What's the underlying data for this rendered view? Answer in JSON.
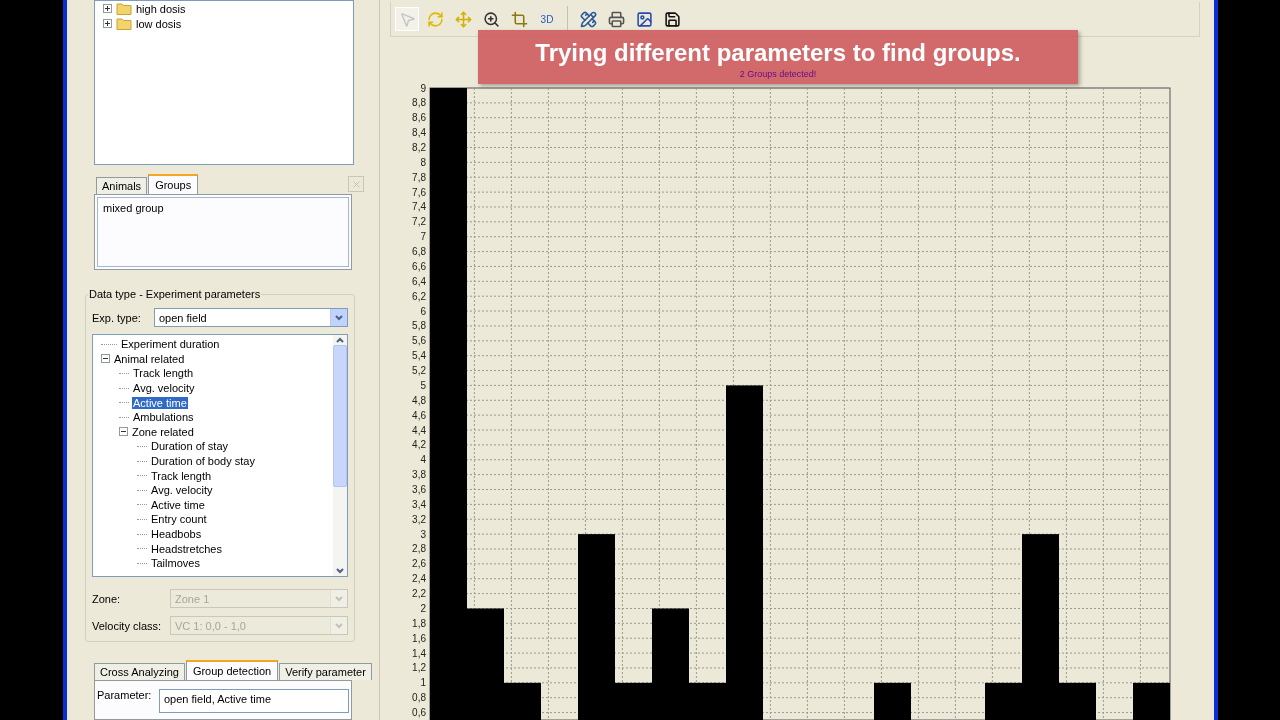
{
  "top_tree": {
    "items": [
      {
        "label": "high dosis",
        "expanded": false
      },
      {
        "label": "low dosis",
        "expanded": false
      }
    ]
  },
  "list_tabs": [
    {
      "label": "Animals",
      "selected": false
    },
    {
      "label": "Groups",
      "selected": true
    }
  ],
  "groups_list": {
    "items": [
      "mixed group"
    ]
  },
  "parameters_group": {
    "title": "Data type - Experiment parameters",
    "exp_type": {
      "label": "Exp. type:",
      "value": "open field",
      "disabled": false
    },
    "tree": [
      {
        "label": "Experiment duration",
        "selected": false
      },
      {
        "label": "Animal related",
        "selected": false,
        "expanded": true,
        "children": [
          {
            "label": "Track length",
            "selected": false
          },
          {
            "label": "Avg. velocity",
            "selected": false
          },
          {
            "label": "Active time",
            "selected": true
          },
          {
            "label": "Ambulations",
            "selected": false
          },
          {
            "label": "Zone related",
            "selected": false,
            "expanded": true,
            "children": [
              {
                "label": "Duration of stay",
                "selected": false
              },
              {
                "label": "Duration of body stay",
                "selected": false
              },
              {
                "label": "Track length",
                "selected": false
              },
              {
                "label": "Avg. velocity",
                "selected": false
              },
              {
                "label": "Active time",
                "selected": false
              },
              {
                "label": "Entry count",
                "selected": false
              },
              {
                "label": "Headbobs",
                "selected": false
              },
              {
                "label": "Headstretches",
                "selected": false
              },
              {
                "label": "Tailmoves",
                "selected": false
              }
            ]
          }
        ]
      }
    ]
  },
  "zone": {
    "label": "Zone:",
    "value": "Zone 1",
    "disabled": true
  },
  "velocity_class": {
    "label": "Velocity class:",
    "value": "VC 1: 0,0 - 1,0",
    "disabled": true
  },
  "bottom_tabs": [
    {
      "label": "Cross Analyzing",
      "selected": false
    },
    {
      "label": "Group detection",
      "selected": true
    },
    {
      "label": "Verify parameter",
      "selected": false
    }
  ],
  "parameter": {
    "label": "Parameter:",
    "value": "open field, Active time"
  },
  "toolbar": {
    "buttons": [
      {
        "kind": "icon",
        "disabled": true
      },
      {
        "kind": "icon",
        "disabled": false
      },
      {
        "kind": "icon",
        "disabled": false
      },
      {
        "kind": "icon",
        "disabled": false
      },
      {
        "kind": "icon",
        "disabled": false
      },
      {
        "kind": "text",
        "label": "3D",
        "disabled": false
      },
      {
        "kind": "separator"
      },
      {
        "kind": "icon",
        "disabled": false
      },
      {
        "kind": "icon",
        "disabled": false
      },
      {
        "kind": "icon",
        "disabled": false
      },
      {
        "kind": "icon",
        "disabled": false
      }
    ]
  },
  "caption": "Trying different parameters to find groups.",
  "status": "2 Groups detected!",
  "chart_data": {
    "type": "bar",
    "grid": true,
    "series": [
      {
        "color": "#000000",
        "values": [
          9,
          2,
          1,
          null,
          3,
          1,
          2,
          1,
          5,
          null,
          null,
          null,
          1,
          null,
          null,
          1,
          3,
          1,
          null,
          1
        ]
      }
    ],
    "ylim": [
      0.5,
      9
    ],
    "yticks": [
      {
        "value": 9,
        "label": "9"
      },
      {
        "value": 8.8,
        "label": "8,8"
      },
      {
        "value": 8.6,
        "label": "8,6"
      },
      {
        "value": 8.4,
        "label": "8,4"
      },
      {
        "value": 8.2,
        "label": "8,2"
      },
      {
        "value": 8,
        "label": "8"
      },
      {
        "value": 7.8,
        "label": "7,8"
      },
      {
        "value": 7.6,
        "label": "7,6"
      },
      {
        "value": 7.4,
        "label": "7,4"
      },
      {
        "value": 7.2,
        "label": "7,2"
      },
      {
        "value": 7,
        "label": "7"
      },
      {
        "value": 6.8,
        "label": "6,8"
      },
      {
        "value": 6.6,
        "label": "6,6"
      },
      {
        "value": 6.4,
        "label": "6,4"
      },
      {
        "value": 6.2,
        "label": "6,2"
      },
      {
        "value": 6,
        "label": "6"
      },
      {
        "value": 5.8,
        "label": "5,8"
      },
      {
        "value": 5.6,
        "label": "5,6"
      },
      {
        "value": 5.4,
        "label": "5,4"
      },
      {
        "value": 5.2,
        "label": "5,2"
      },
      {
        "value": 5,
        "label": "5"
      },
      {
        "value": 4.8,
        "label": "4,8"
      },
      {
        "value": 4.6,
        "label": "4,6"
      },
      {
        "value": 4.4,
        "label": "4,4"
      },
      {
        "value": 4.2,
        "label": "4,2"
      },
      {
        "value": 4,
        "label": "4"
      },
      {
        "value": 3.8,
        "label": "3,8"
      },
      {
        "value": 3.6,
        "label": "3,6"
      },
      {
        "value": 3.4,
        "label": "3,4"
      },
      {
        "value": 3.2,
        "label": "3,2"
      },
      {
        "value": 3,
        "label": "3"
      },
      {
        "value": 2.8,
        "label": "2,8"
      },
      {
        "value": 2.6,
        "label": "2,6"
      },
      {
        "value": 2.4,
        "label": "2,4"
      },
      {
        "value": 2.2,
        "label": "2,2"
      },
      {
        "value": 2,
        "label": "2"
      },
      {
        "value": 1.8,
        "label": "1,8"
      },
      {
        "value": 1.6,
        "label": "1,6"
      },
      {
        "value": 1.4,
        "label": "1,4"
      },
      {
        "value": 1.2,
        "label": "1,2"
      },
      {
        "value": 1,
        "label": "1"
      },
      {
        "value": 0.8,
        "label": "0,8"
      },
      {
        "value": 0.6,
        "label": "0,6"
      }
    ]
  }
}
